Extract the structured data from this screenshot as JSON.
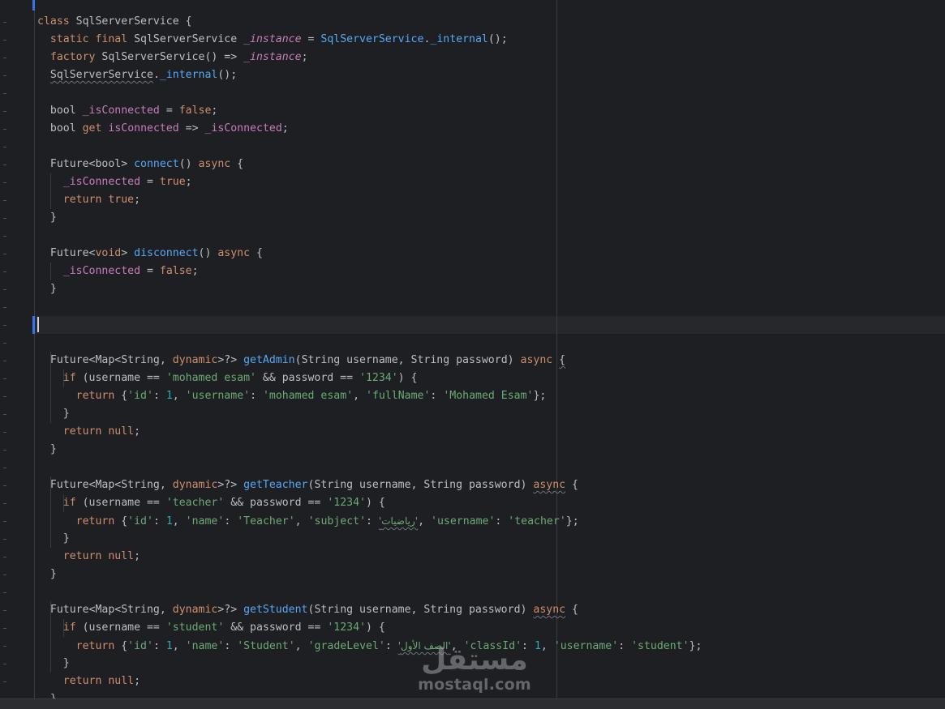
{
  "editor": {
    "language": "dart",
    "colors": {
      "background": "#1e1f22",
      "keyword": "#cf8e6d",
      "function": "#56a8f5",
      "field": "#c77dbb",
      "string": "#6aab73",
      "number": "#2aacb8",
      "text": "#bcbec4"
    },
    "lines": [
      [
        {
          "t": "class",
          "c": "kw"
        },
        {
          "t": " SqlServerService {",
          "c": "pl"
        }
      ],
      [
        {
          "t": "  "
        },
        {
          "t": "static final",
          "c": "kw"
        },
        {
          "t": " SqlServerService ",
          "c": "pl"
        },
        {
          "t": "_instance",
          "c": "it"
        },
        {
          "t": " = ",
          "c": "pl"
        },
        {
          "t": "SqlServerService",
          "c": "fn"
        },
        {
          "t": ".",
          "c": "pl"
        },
        {
          "t": "_internal",
          "c": "fn"
        },
        {
          "t": "();",
          "c": "pl"
        }
      ],
      [
        {
          "t": "  "
        },
        {
          "t": "factory",
          "c": "kw"
        },
        {
          "t": " SqlServerService() => ",
          "c": "pl"
        },
        {
          "t": "_instance",
          "c": "it"
        },
        {
          "t": ";",
          "c": "pl"
        }
      ],
      [
        {
          "t": "  "
        },
        {
          "t": "SqlServerService",
          "c": "pl",
          "sq": true
        },
        {
          "t": ".",
          "c": "pl"
        },
        {
          "t": "_internal",
          "c": "fn"
        },
        {
          "t": "();",
          "c": "pl"
        }
      ],
      [],
      [
        {
          "t": "  "
        },
        {
          "t": "bool ",
          "c": "pl"
        },
        {
          "t": "_isConnected",
          "c": "fld"
        },
        {
          "t": " = ",
          "c": "pl"
        },
        {
          "t": "false",
          "c": "kw"
        },
        {
          "t": ";",
          "c": "pl"
        }
      ],
      [
        {
          "t": "  "
        },
        {
          "t": "bool ",
          "c": "pl"
        },
        {
          "t": "get",
          "c": "kw"
        },
        {
          "t": " ",
          "c": "pl"
        },
        {
          "t": "isConnected",
          "c": "fld"
        },
        {
          "t": " => ",
          "c": "pl"
        },
        {
          "t": "_isConnected",
          "c": "fld"
        },
        {
          "t": ";",
          "c": "pl"
        }
      ],
      [],
      [
        {
          "t": "  "
        },
        {
          "t": "Future<bool> ",
          "c": "pl"
        },
        {
          "t": "connect",
          "c": "fn"
        },
        {
          "t": "() ",
          "c": "pl"
        },
        {
          "t": "async",
          "c": "kw"
        },
        {
          "t": " {",
          "c": "pl"
        }
      ],
      [
        {
          "t": "    "
        },
        {
          "t": "_isConnected",
          "c": "fld"
        },
        {
          "t": " = ",
          "c": "pl"
        },
        {
          "t": "true",
          "c": "kw"
        },
        {
          "t": ";",
          "c": "pl"
        }
      ],
      [
        {
          "t": "    "
        },
        {
          "t": "return",
          "c": "kw"
        },
        {
          "t": " ",
          "c": "pl"
        },
        {
          "t": "true",
          "c": "kw"
        },
        {
          "t": ";",
          "c": "pl"
        }
      ],
      [
        {
          "t": "  }",
          "c": "pl"
        }
      ],
      [],
      [
        {
          "t": "  "
        },
        {
          "t": "Future<",
          "c": "pl"
        },
        {
          "t": "void",
          "c": "kw"
        },
        {
          "t": "> ",
          "c": "pl"
        },
        {
          "t": "disconnect",
          "c": "fn"
        },
        {
          "t": "() ",
          "c": "pl"
        },
        {
          "t": "async",
          "c": "kw"
        },
        {
          "t": " {",
          "c": "pl"
        }
      ],
      [
        {
          "t": "    "
        },
        {
          "t": "_isConnected",
          "c": "fld"
        },
        {
          "t": " = ",
          "c": "pl"
        },
        {
          "t": "false",
          "c": "kw"
        },
        {
          "t": ";",
          "c": "pl"
        }
      ],
      [
        {
          "t": "  }",
          "c": "pl"
        }
      ],
      [],
      [],
      [],
      [
        {
          "t": "  "
        },
        {
          "t": "Future<Map<String, ",
          "c": "pl"
        },
        {
          "t": "dynamic",
          "c": "kw"
        },
        {
          "t": ">?> ",
          "c": "pl"
        },
        {
          "t": "getAdmin",
          "c": "fn"
        },
        {
          "t": "(String username, String password) ",
          "c": "pl"
        },
        {
          "t": "async",
          "c": "kw"
        },
        {
          "t": " ",
          "c": "pl"
        },
        {
          "t": "{",
          "c": "pl",
          "sq": true
        }
      ],
      [
        {
          "t": "    "
        },
        {
          "t": "if",
          "c": "kw"
        },
        {
          "t": " (username == ",
          "c": "pl"
        },
        {
          "t": "'mohamed esam'",
          "c": "str"
        },
        {
          "t": " && password == ",
          "c": "pl"
        },
        {
          "t": "'1234'",
          "c": "str"
        },
        {
          "t": ") {",
          "c": "pl"
        }
      ],
      [
        {
          "t": "      "
        },
        {
          "t": "return",
          "c": "kw"
        },
        {
          "t": " {",
          "c": "pl"
        },
        {
          "t": "'id'",
          "c": "str"
        },
        {
          "t": ": ",
          "c": "pl"
        },
        {
          "t": "1",
          "c": "num"
        },
        {
          "t": ", ",
          "c": "pl"
        },
        {
          "t": "'username'",
          "c": "str"
        },
        {
          "t": ": ",
          "c": "pl"
        },
        {
          "t": "'mohamed esam'",
          "c": "str"
        },
        {
          "t": ", ",
          "c": "pl"
        },
        {
          "t": "'fullName'",
          "c": "str"
        },
        {
          "t": ": ",
          "c": "pl"
        },
        {
          "t": "'Mohamed Esam'",
          "c": "str"
        },
        {
          "t": "};",
          "c": "pl"
        }
      ],
      [
        {
          "t": "    }",
          "c": "pl"
        }
      ],
      [
        {
          "t": "    "
        },
        {
          "t": "return",
          "c": "kw"
        },
        {
          "t": " ",
          "c": "pl"
        },
        {
          "t": "null",
          "c": "kw"
        },
        {
          "t": ";",
          "c": "pl"
        }
      ],
      [
        {
          "t": "  }",
          "c": "pl"
        }
      ],
      [],
      [
        {
          "t": "  "
        },
        {
          "t": "Future<Map<String, ",
          "c": "pl"
        },
        {
          "t": "dynamic",
          "c": "kw"
        },
        {
          "t": ">?> ",
          "c": "pl"
        },
        {
          "t": "getTeacher",
          "c": "fn"
        },
        {
          "t": "(String username, String password) ",
          "c": "pl"
        },
        {
          "t": "async",
          "c": "kw",
          "sq": true
        },
        {
          "t": " {",
          "c": "pl"
        }
      ],
      [
        {
          "t": "    "
        },
        {
          "t": "if",
          "c": "kw"
        },
        {
          "t": " (username == ",
          "c": "pl"
        },
        {
          "t": "'teacher'",
          "c": "str"
        },
        {
          "t": " && password == ",
          "c": "pl"
        },
        {
          "t": "'1234'",
          "c": "str"
        },
        {
          "t": ") {",
          "c": "pl"
        }
      ],
      [
        {
          "t": "      "
        },
        {
          "t": "return",
          "c": "kw"
        },
        {
          "t": " {",
          "c": "pl"
        },
        {
          "t": "'id'",
          "c": "str"
        },
        {
          "t": ": ",
          "c": "pl"
        },
        {
          "t": "1",
          "c": "num"
        },
        {
          "t": ", ",
          "c": "pl"
        },
        {
          "t": "'name'",
          "c": "str"
        },
        {
          "t": ": ",
          "c": "pl"
        },
        {
          "t": "'Teacher'",
          "c": "str"
        },
        {
          "t": ", ",
          "c": "pl"
        },
        {
          "t": "'subject'",
          "c": "str"
        },
        {
          "t": ": ",
          "c": "pl"
        },
        {
          "t": "'رياضيات'",
          "c": "str",
          "sq": true
        },
        {
          "t": ", ",
          "c": "pl"
        },
        {
          "t": "'username'",
          "c": "str"
        },
        {
          "t": ": ",
          "c": "pl"
        },
        {
          "t": "'teacher'",
          "c": "str"
        },
        {
          "t": "};",
          "c": "pl"
        }
      ],
      [
        {
          "t": "    }",
          "c": "pl"
        }
      ],
      [
        {
          "t": "    "
        },
        {
          "t": "return",
          "c": "kw"
        },
        {
          "t": " ",
          "c": "pl"
        },
        {
          "t": "null",
          "c": "kw"
        },
        {
          "t": ";",
          "c": "pl"
        }
      ],
      [
        {
          "t": "  }",
          "c": "pl"
        }
      ],
      [],
      [
        {
          "t": "  "
        },
        {
          "t": "Future<Map<String, ",
          "c": "pl"
        },
        {
          "t": "dynamic",
          "c": "kw"
        },
        {
          "t": ">?> ",
          "c": "pl"
        },
        {
          "t": "getStudent",
          "c": "fn"
        },
        {
          "t": "(String username, String password) ",
          "c": "pl"
        },
        {
          "t": "async",
          "c": "kw",
          "sq": true
        },
        {
          "t": " {",
          "c": "pl"
        }
      ],
      [
        {
          "t": "    "
        },
        {
          "t": "if",
          "c": "kw"
        },
        {
          "t": " (username == ",
          "c": "pl"
        },
        {
          "t": "'student'",
          "c": "str"
        },
        {
          "t": " && password == ",
          "c": "pl"
        },
        {
          "t": "'1234'",
          "c": "str"
        },
        {
          "t": ") {",
          "c": "pl"
        }
      ],
      [
        {
          "t": "      "
        },
        {
          "t": "return",
          "c": "kw"
        },
        {
          "t": " {",
          "c": "pl"
        },
        {
          "t": "'id'",
          "c": "str"
        },
        {
          "t": ": ",
          "c": "pl"
        },
        {
          "t": "1",
          "c": "num"
        },
        {
          "t": ", ",
          "c": "pl"
        },
        {
          "t": "'name'",
          "c": "str"
        },
        {
          "t": ": ",
          "c": "pl"
        },
        {
          "t": "'Student'",
          "c": "str"
        },
        {
          "t": ", ",
          "c": "pl"
        },
        {
          "t": "'gradeLevel'",
          "c": "str"
        },
        {
          "t": ": ",
          "c": "pl"
        },
        {
          "t": "'الصف الأول'",
          "c": "str",
          "sq": true
        },
        {
          "t": ", ",
          "c": "pl"
        },
        {
          "t": "'classId'",
          "c": "str"
        },
        {
          "t": ": ",
          "c": "pl"
        },
        {
          "t": "1",
          "c": "num"
        },
        {
          "t": ", ",
          "c": "pl"
        },
        {
          "t": "'username'",
          "c": "str"
        },
        {
          "t": ": ",
          "c": "pl"
        },
        {
          "t": "'student'",
          "c": "str"
        },
        {
          "t": "};",
          "c": "pl"
        }
      ],
      [
        {
          "t": "    }",
          "c": "pl"
        }
      ],
      [
        {
          "t": "    "
        },
        {
          "t": "return",
          "c": "kw"
        },
        {
          "t": " ",
          "c": "pl"
        },
        {
          "t": "null",
          "c": "kw"
        },
        {
          "t": ";",
          "c": "pl"
        }
      ],
      [
        {
          "t": "  }",
          "c": "pl"
        }
      ]
    ]
  },
  "watermark": {
    "arabic": "مستقل",
    "latin": "mostaql.com"
  }
}
